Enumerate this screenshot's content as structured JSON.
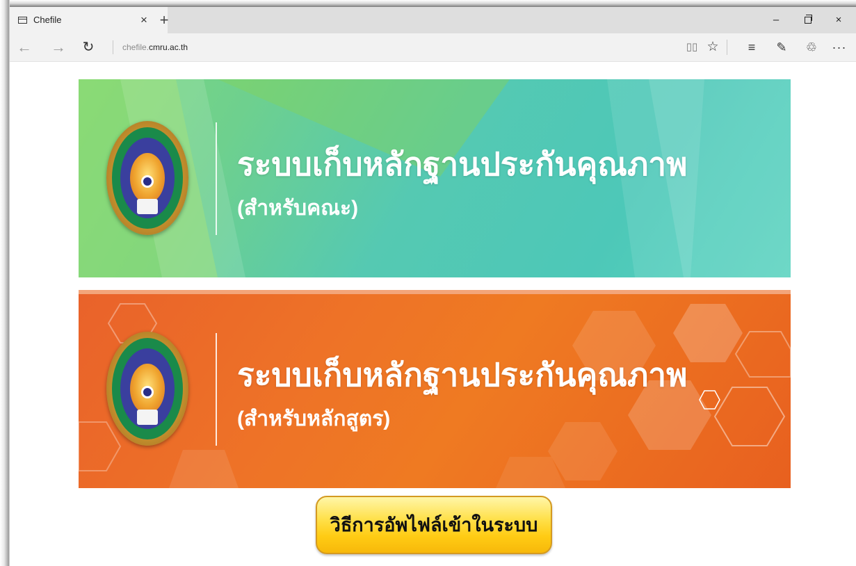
{
  "browser": {
    "tab": {
      "title": "Chefile",
      "close_glyph": "×",
      "new_tab_glyph": "+"
    },
    "window_controls": {
      "minimize": "–",
      "close": "×"
    },
    "address": {
      "prefix": "chefile.",
      "domain": "cmru.ac.th"
    },
    "nav": {
      "back": "←",
      "forward": "→",
      "refresh": "↻"
    },
    "toolbar": {
      "reading_view": "▯▯",
      "favorite": "☆",
      "hub": "≡",
      "note": "✎",
      "share": "♲",
      "more": "···"
    }
  },
  "banners": [
    {
      "title": "ระบบเก็บหลักฐานประกันคุณภาพ",
      "subtitle": "(สำหรับคณะ)",
      "color": "#4dc8b8"
    },
    {
      "title": "ระบบเก็บหลักฐานประกันคุณภาพ",
      "subtitle": "(สำหรับหลักสูตร)",
      "color": "#ee7327"
    }
  ],
  "howto_button": {
    "label": "วิธีการอัพไฟล์เข้าในระบบ",
    "color": "#ffd21f"
  }
}
